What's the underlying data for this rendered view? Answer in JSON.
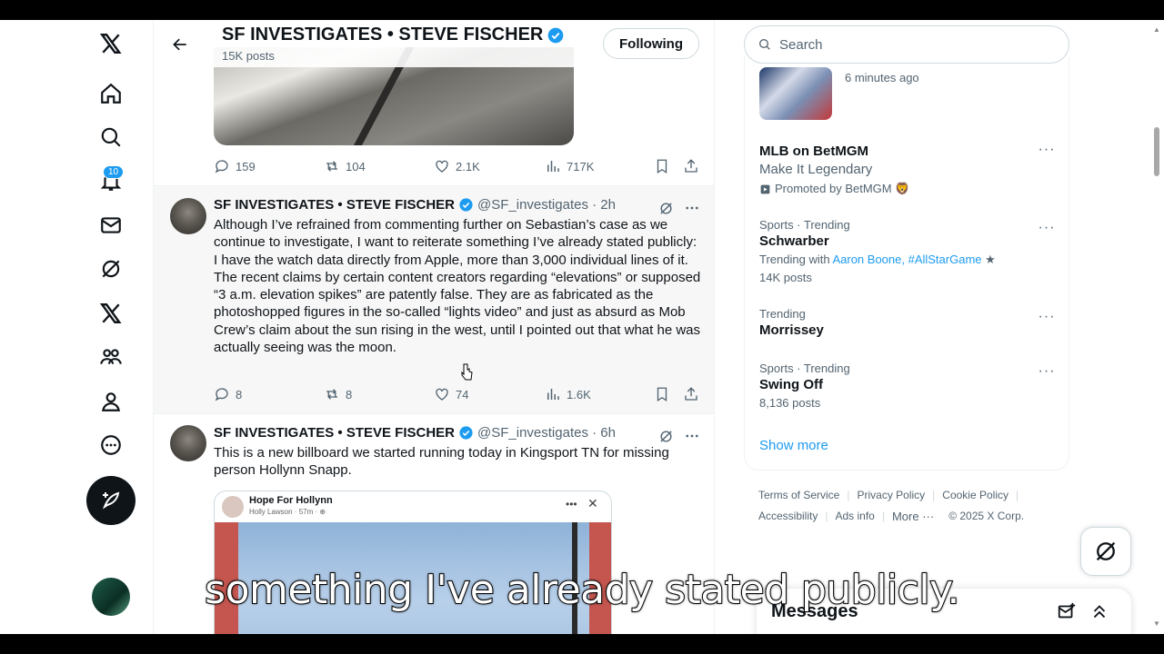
{
  "header": {
    "name": "SF INVESTIGATES • STEVE FISCHER",
    "post_count": "15K posts",
    "follow_label": "Following"
  },
  "nav": {
    "notification_count": "10",
    "items": [
      "x-logo",
      "home",
      "explore",
      "notifications",
      "messages",
      "grok",
      "premium",
      "communities",
      "profile",
      "more"
    ]
  },
  "tweet0_stats": {
    "replies": "159",
    "reposts": "104",
    "likes": "2.1K",
    "views": "717K"
  },
  "tweets": [
    {
      "name": "SF INVESTIGATES • STEVE FISCHER",
      "handle": "@SF_investigates · 2h",
      "text": "Although I’ve refrained from commenting further on Sebastian’s case as we continue to investigate, I want to reiterate something I’ve already stated publicly: I have the watch data directly from Apple, more than 3,000 individual lines of it. The recent claims by certain content creators regarding “elevations” or supposed “3 a.m. elevation spikes” are patently false. They are as fabricated as the photoshopped figures in the so-called “lights video” and just as absurd as Mob Crew’s claim about the sun rising in the west, until I pointed out that what he was actually seeing was the moon.",
      "replies": "8",
      "reposts": "8",
      "likes": "74",
      "views": "1.6K"
    },
    {
      "name": "SF INVESTIGATES • STEVE FISCHER",
      "handle": "@SF_investigates · 6h",
      "text": "This is a new billboard we started running today in Kingsport TN for missing person Hollynn Snapp.",
      "card_title": "Hope For Hollynn",
      "card_sub": "Holly Lawson · 57m · ⊕"
    }
  ],
  "sidebar": {
    "search_placeholder": "Search",
    "news_time": "6 minutes ago",
    "promo": {
      "title": "MLB on BetMGM",
      "subtitle": "Make It Legendary",
      "promoted": "Promoted by BetMGM 🦁"
    },
    "trends": [
      {
        "meta": "Sports · Trending",
        "title": "Schwarber",
        "with_prefix": "Trending with",
        "with_links": "Aaron Boone, #AllStarGame",
        "count": "14K posts"
      },
      {
        "meta": "Trending",
        "title": "Morrissey"
      },
      {
        "meta": "Sports · Trending",
        "title": "Swing Off",
        "count": "8,136 posts"
      }
    ],
    "show_more": "Show more",
    "footer": [
      "Terms of Service",
      "Privacy Policy",
      "Cookie Policy",
      "Accessibility",
      "Ads info",
      "More ···",
      "© 2025 X Corp."
    ]
  },
  "messages": {
    "title": "Messages"
  },
  "caption": "something I've already stated publicly.",
  "colors": {
    "accent": "#1d9bf0",
    "text": "#0f1419",
    "muted": "#536471"
  }
}
